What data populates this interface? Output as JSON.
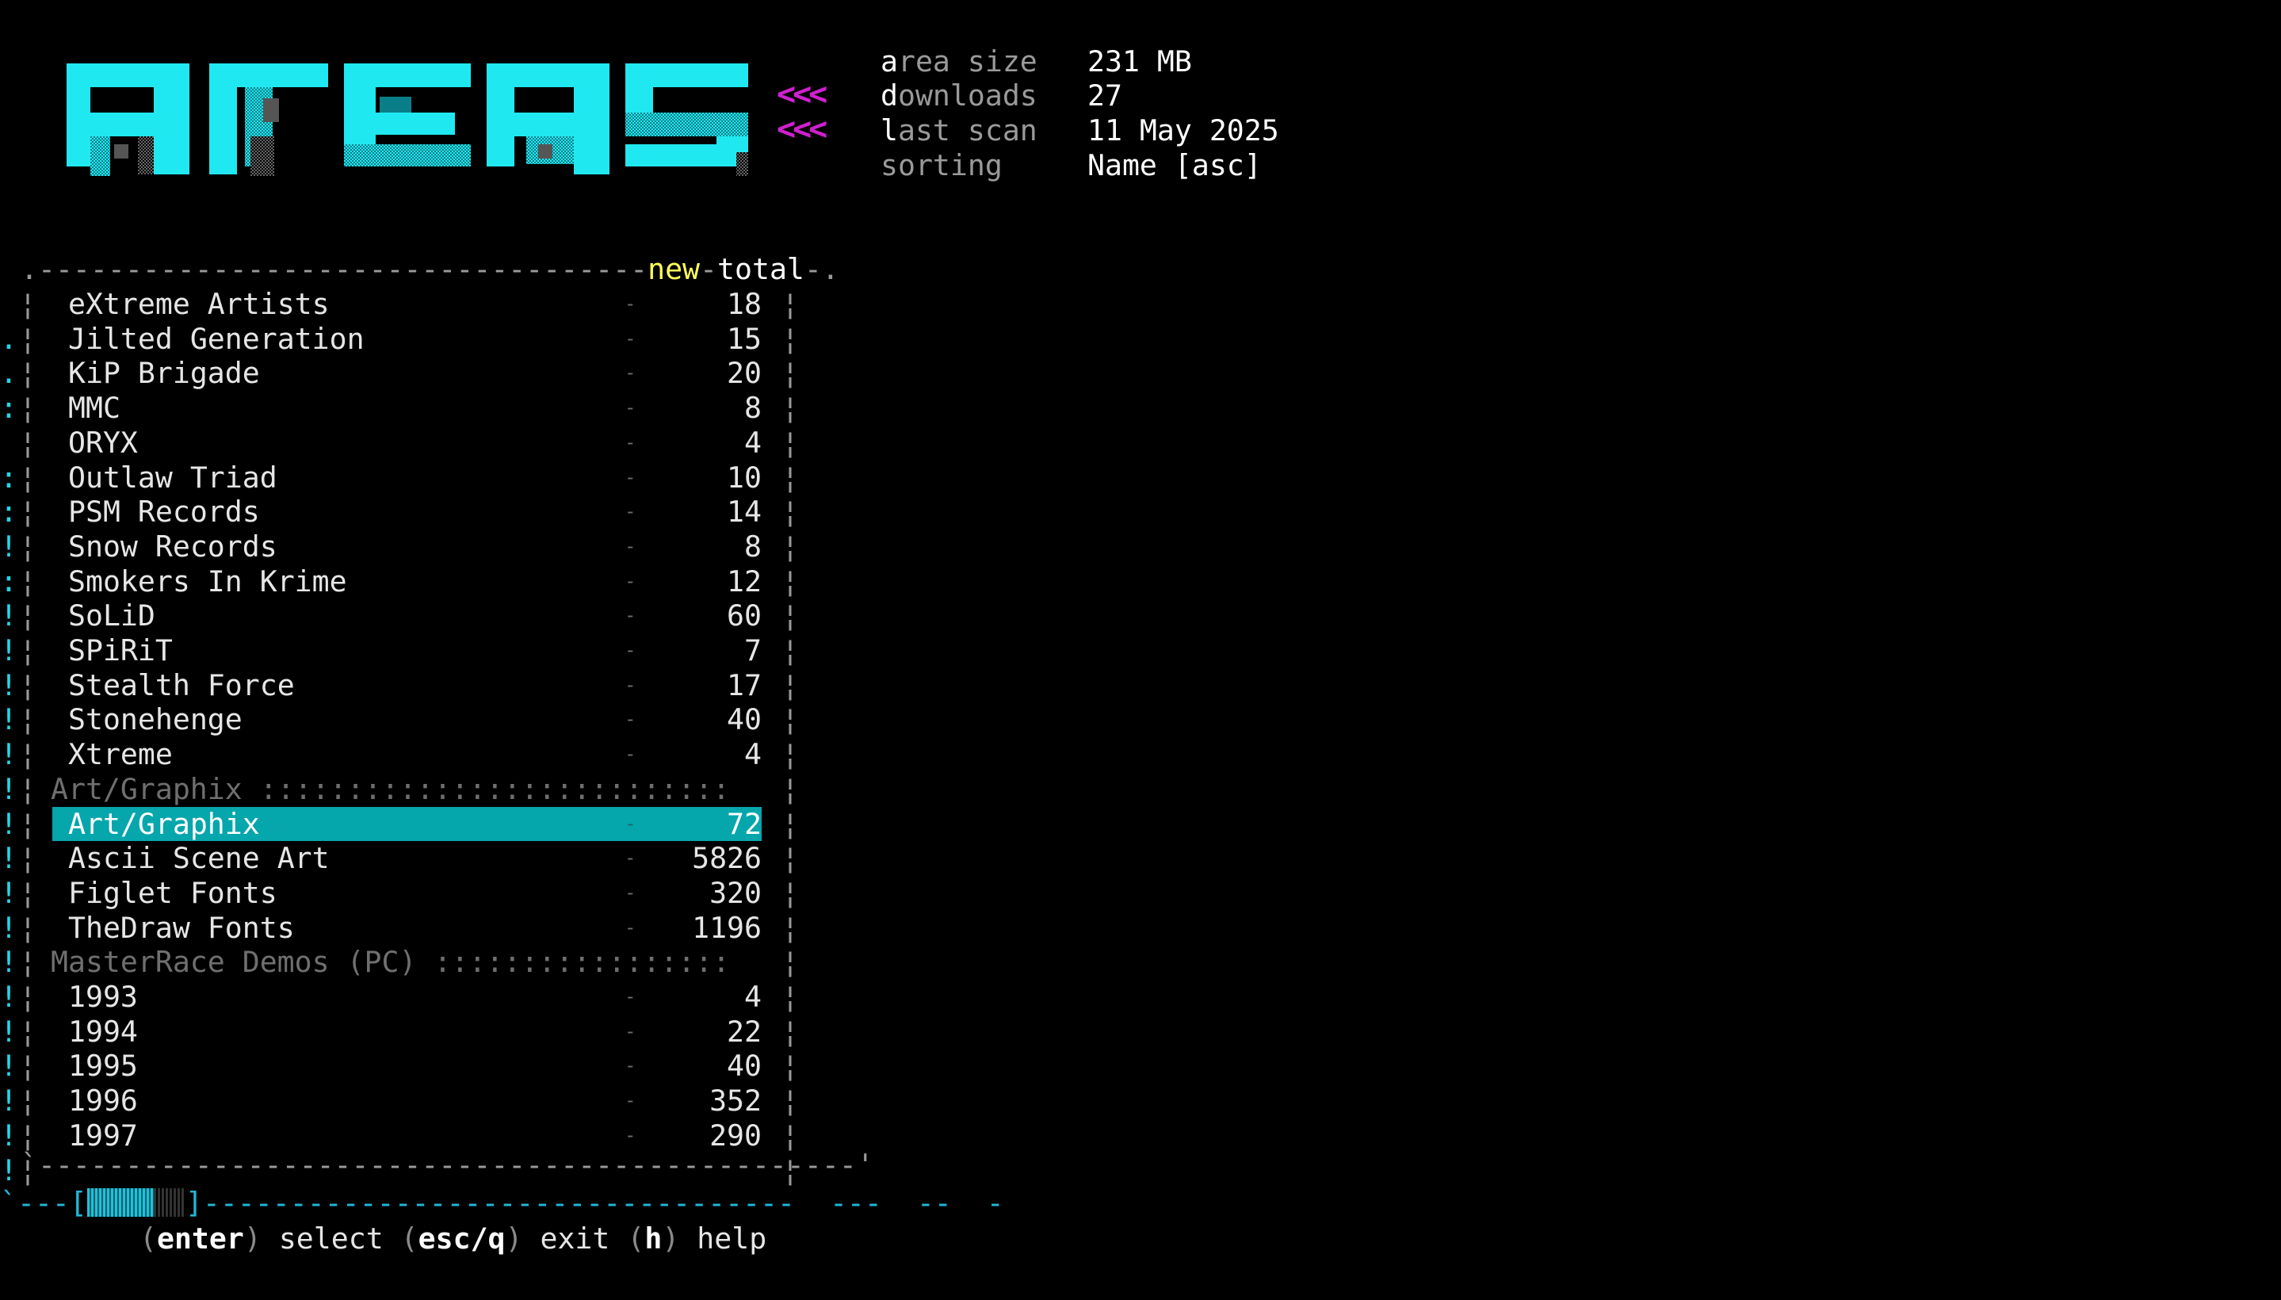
{
  "logo": {
    "text": "AREAS"
  },
  "header": {
    "arrows_1": "<<<",
    "arrows_2": "<<<",
    "info": [
      {
        "label_first": "a",
        "label_rest": "rea size",
        "value": "231 MB"
      },
      {
        "label_first": "d",
        "label_rest": "ownloads",
        "value": "27"
      },
      {
        "label_first": "l",
        "label_rest": "ast scan",
        "value": "11 May 2025"
      },
      {
        "label_first": "",
        "label_rest": "sorting",
        "value": "Name [asc]"
      }
    ]
  },
  "list": {
    "col_new": "new",
    "col_total": "total",
    "rows": [
      {
        "name": "eXtreme Artists",
        "new": "-",
        "total": "18"
      },
      {
        "name": "Jilted Generation",
        "new": "-",
        "total": "15"
      },
      {
        "name": "KiP Brigade",
        "new": "-",
        "total": "20"
      },
      {
        "name": "MMC",
        "new": "-",
        "total": "8"
      },
      {
        "name": "ORYX",
        "new": "-",
        "total": "4"
      },
      {
        "name": "Outlaw Triad",
        "new": "-",
        "total": "10"
      },
      {
        "name": "PSM Records",
        "new": "-",
        "total": "14"
      },
      {
        "name": "Snow Records",
        "new": "-",
        "total": "8"
      },
      {
        "name": "Smokers In Krime",
        "new": "-",
        "total": "12"
      },
      {
        "name": "SoLiD",
        "new": "-",
        "total": "60"
      },
      {
        "name": "SPiRiT",
        "new": "-",
        "total": "7"
      },
      {
        "name": "Stealth Force",
        "new": "-",
        "total": "17"
      },
      {
        "name": "Stonehenge",
        "new": "-",
        "total": "40"
      },
      {
        "name": "Xtreme",
        "new": "-",
        "total": "4"
      }
    ],
    "section_art": "Art/Graphix :::::::::::::::::::::::::::",
    "art_rows": [
      {
        "name": "Art/Graphix",
        "new": "-",
        "total": "72",
        "selected": true
      },
      {
        "name": "Ascii Scene Art",
        "new": "-",
        "total": "5826"
      },
      {
        "name": "Figlet Fonts",
        "new": "-",
        "total": "320"
      },
      {
        "name": "TheDraw Fonts",
        "new": "-",
        "total": "1196"
      }
    ],
    "section_demos": "MasterRace Demos (PC) :::::::::::::::::",
    "demo_rows": [
      {
        "name": "1993",
        "new": "-",
        "total": "4"
      },
      {
        "name": "1994",
        "new": "-",
        "total": "22"
      },
      {
        "name": "1995",
        "new": "-",
        "total": "40"
      },
      {
        "name": "1996",
        "new": "-",
        "total": "352"
      },
      {
        "name": "1997",
        "new": "-",
        "total": "290"
      }
    ]
  },
  "scroll": {
    "position_fraction": 0.0
  },
  "help": {
    "enter_key": "enter",
    "enter_label": " select ",
    "esc_key": "esc/q",
    "esc_label": " exit ",
    "h_key": "h",
    "h_label": " help"
  },
  "colors": {
    "accent": "#05a6ac",
    "logo": "#20e8f0",
    "arrows": "#d020d0",
    "new_header": "#ffff5a"
  }
}
